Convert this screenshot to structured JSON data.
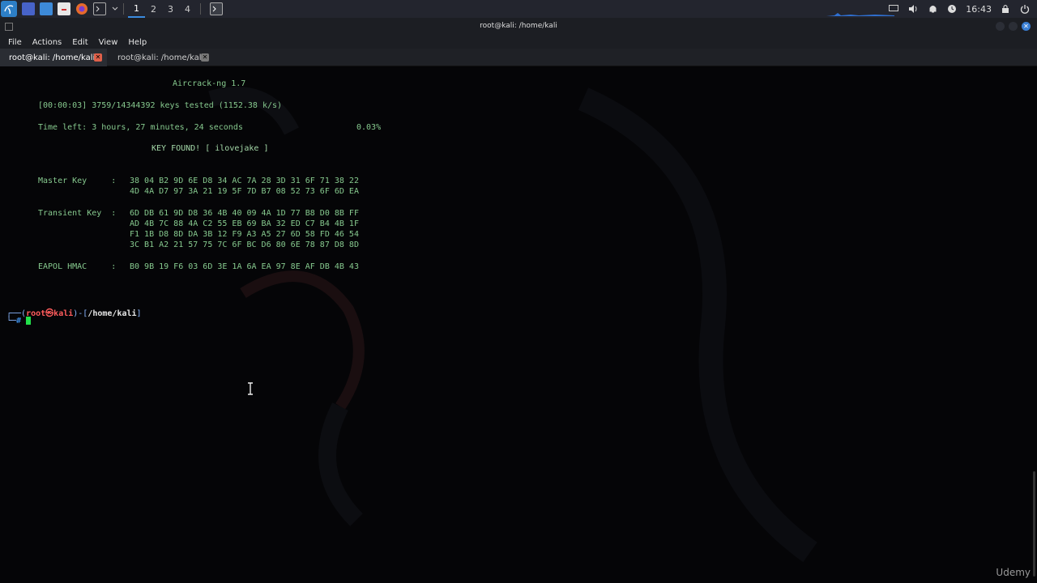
{
  "panel": {
    "workspaces": [
      "1",
      "2",
      "3",
      "4"
    ],
    "active_workspace": 0,
    "clock": "16:43"
  },
  "window": {
    "title": "root@kali: /home/kali"
  },
  "menubar": {
    "items": [
      "File",
      "Actions",
      "Edit",
      "View",
      "Help"
    ]
  },
  "tabs": [
    {
      "label": "root@kali: /home/kali",
      "active": true
    },
    {
      "label": "root@kali: /home/kali",
      "active": false
    }
  ],
  "terminal": {
    "title": "Aircrack-ng 1.7",
    "progress": "[00:00:03] 3759/14344392 keys tested (1152.38 k/s)",
    "time_left": "Time left: 3 hours, 27 minutes, 24 seconds",
    "percent": "0.03%",
    "key_found": "KEY FOUND! [ ilovejake ]",
    "master_key_label": "Master Key     :",
    "master_key": [
      "38 04 B2 9D 6E D8 34 AC 7A 28 3D 31 6F 71 38 22",
      "4D 4A D7 97 3A 21 19 5F 7D B7 08 52 73 6F 6D EA"
    ],
    "transient_key_label": "Transient Key  :",
    "transient_key": [
      "6D DB 61 9D D8 36 4B 40 09 4A 1D 77 B8 D0 8B FF",
      "AD 4B 7C 88 4A C2 55 EB 69 BA 32 ED C7 B4 4B 1F",
      "F1 1B D8 8D DA 3B 12 F9 A3 A5 27 6D 58 FD 46 54",
      "3C B1 A2 21 57 75 7C 6F BC D6 80 6E 78 87 D8 8D"
    ],
    "eapol_label": "EAPOL HMAC     :",
    "eapol_hmac": "B0 9B 19 F6 03 6D 3E 1A 6A EA 97 8E AF DB 4B 43",
    "prompt": {
      "frame_top": "┌──(",
      "user": "root㉿kali",
      "mid": ")-[",
      "path": "/home/kali",
      "end": "]",
      "frame_bottom": "└─",
      "hash": "#"
    }
  },
  "watermark": {
    "text": "Udemy"
  },
  "colors": {
    "terminal_text": "#86c98e",
    "accent": "#3b8be0",
    "prompt_user": "#ff5c5c"
  }
}
